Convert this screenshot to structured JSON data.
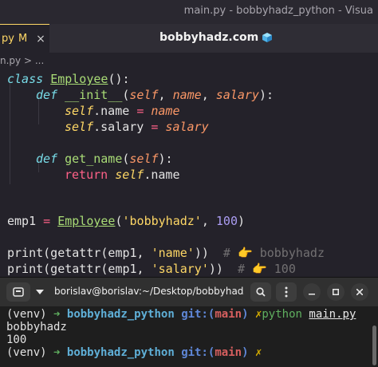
{
  "window": {
    "title": "main.py - bobbyhadz_python - Visua"
  },
  "tab": {
    "name": "py",
    "modified": "M",
    "close": "×"
  },
  "editor_title": "bobbyhadz.com",
  "breadcrumb": "n.py > ...",
  "code": {
    "l1": {
      "kw": "class",
      "name": "Employee",
      "tail": "():"
    },
    "l2": {
      "kw": "def",
      "name": "__init__",
      "open": "(",
      "self": "self",
      "c1": ", ",
      "p1": "name",
      "c2": ", ",
      "p2": "salary",
      "close": "):"
    },
    "l3": {
      "self": "self",
      "attr": ".name ",
      "op": "=",
      "val": " name"
    },
    "l4": {
      "self": "self",
      "attr": ".salary ",
      "op": "=",
      "val": " salary"
    },
    "l6": {
      "kw": "def",
      "name": "get_name",
      "open": "(",
      "self": "self",
      "close": "):"
    },
    "l7": {
      "kw": "return",
      "self": " self",
      "attr": ".name"
    },
    "l10": {
      "var": "emp1 ",
      "op": "=",
      "sp": " ",
      "cls": "Employee",
      "open": "(",
      "str": "'bobbyhadz'",
      "comma": ", ",
      "num": "100",
      "close": ")"
    },
    "l12": {
      "code": "print(getattr(emp1, ",
      "str": "'name'",
      "close": "))",
      "comment": "  # 👉 bobbyhadz"
    },
    "l13": {
      "code": "print(getattr(emp1, ",
      "str": "'salary'",
      "close": "))",
      "comment": "  # 👉 100"
    }
  },
  "terminal": {
    "title": "borislav@borislav:~/Desktop/bobbyhadz_...",
    "prompt_env": "(venv) ",
    "arrow": "➜",
    "dir": "bobbyhadz_python",
    "git_label": "git:(",
    "branch": "main",
    "git_close": ")",
    "dirty": "✗",
    "command": "python",
    "command_arg": "main.py",
    "output": [
      "bobbyhadz",
      "100"
    ]
  }
}
